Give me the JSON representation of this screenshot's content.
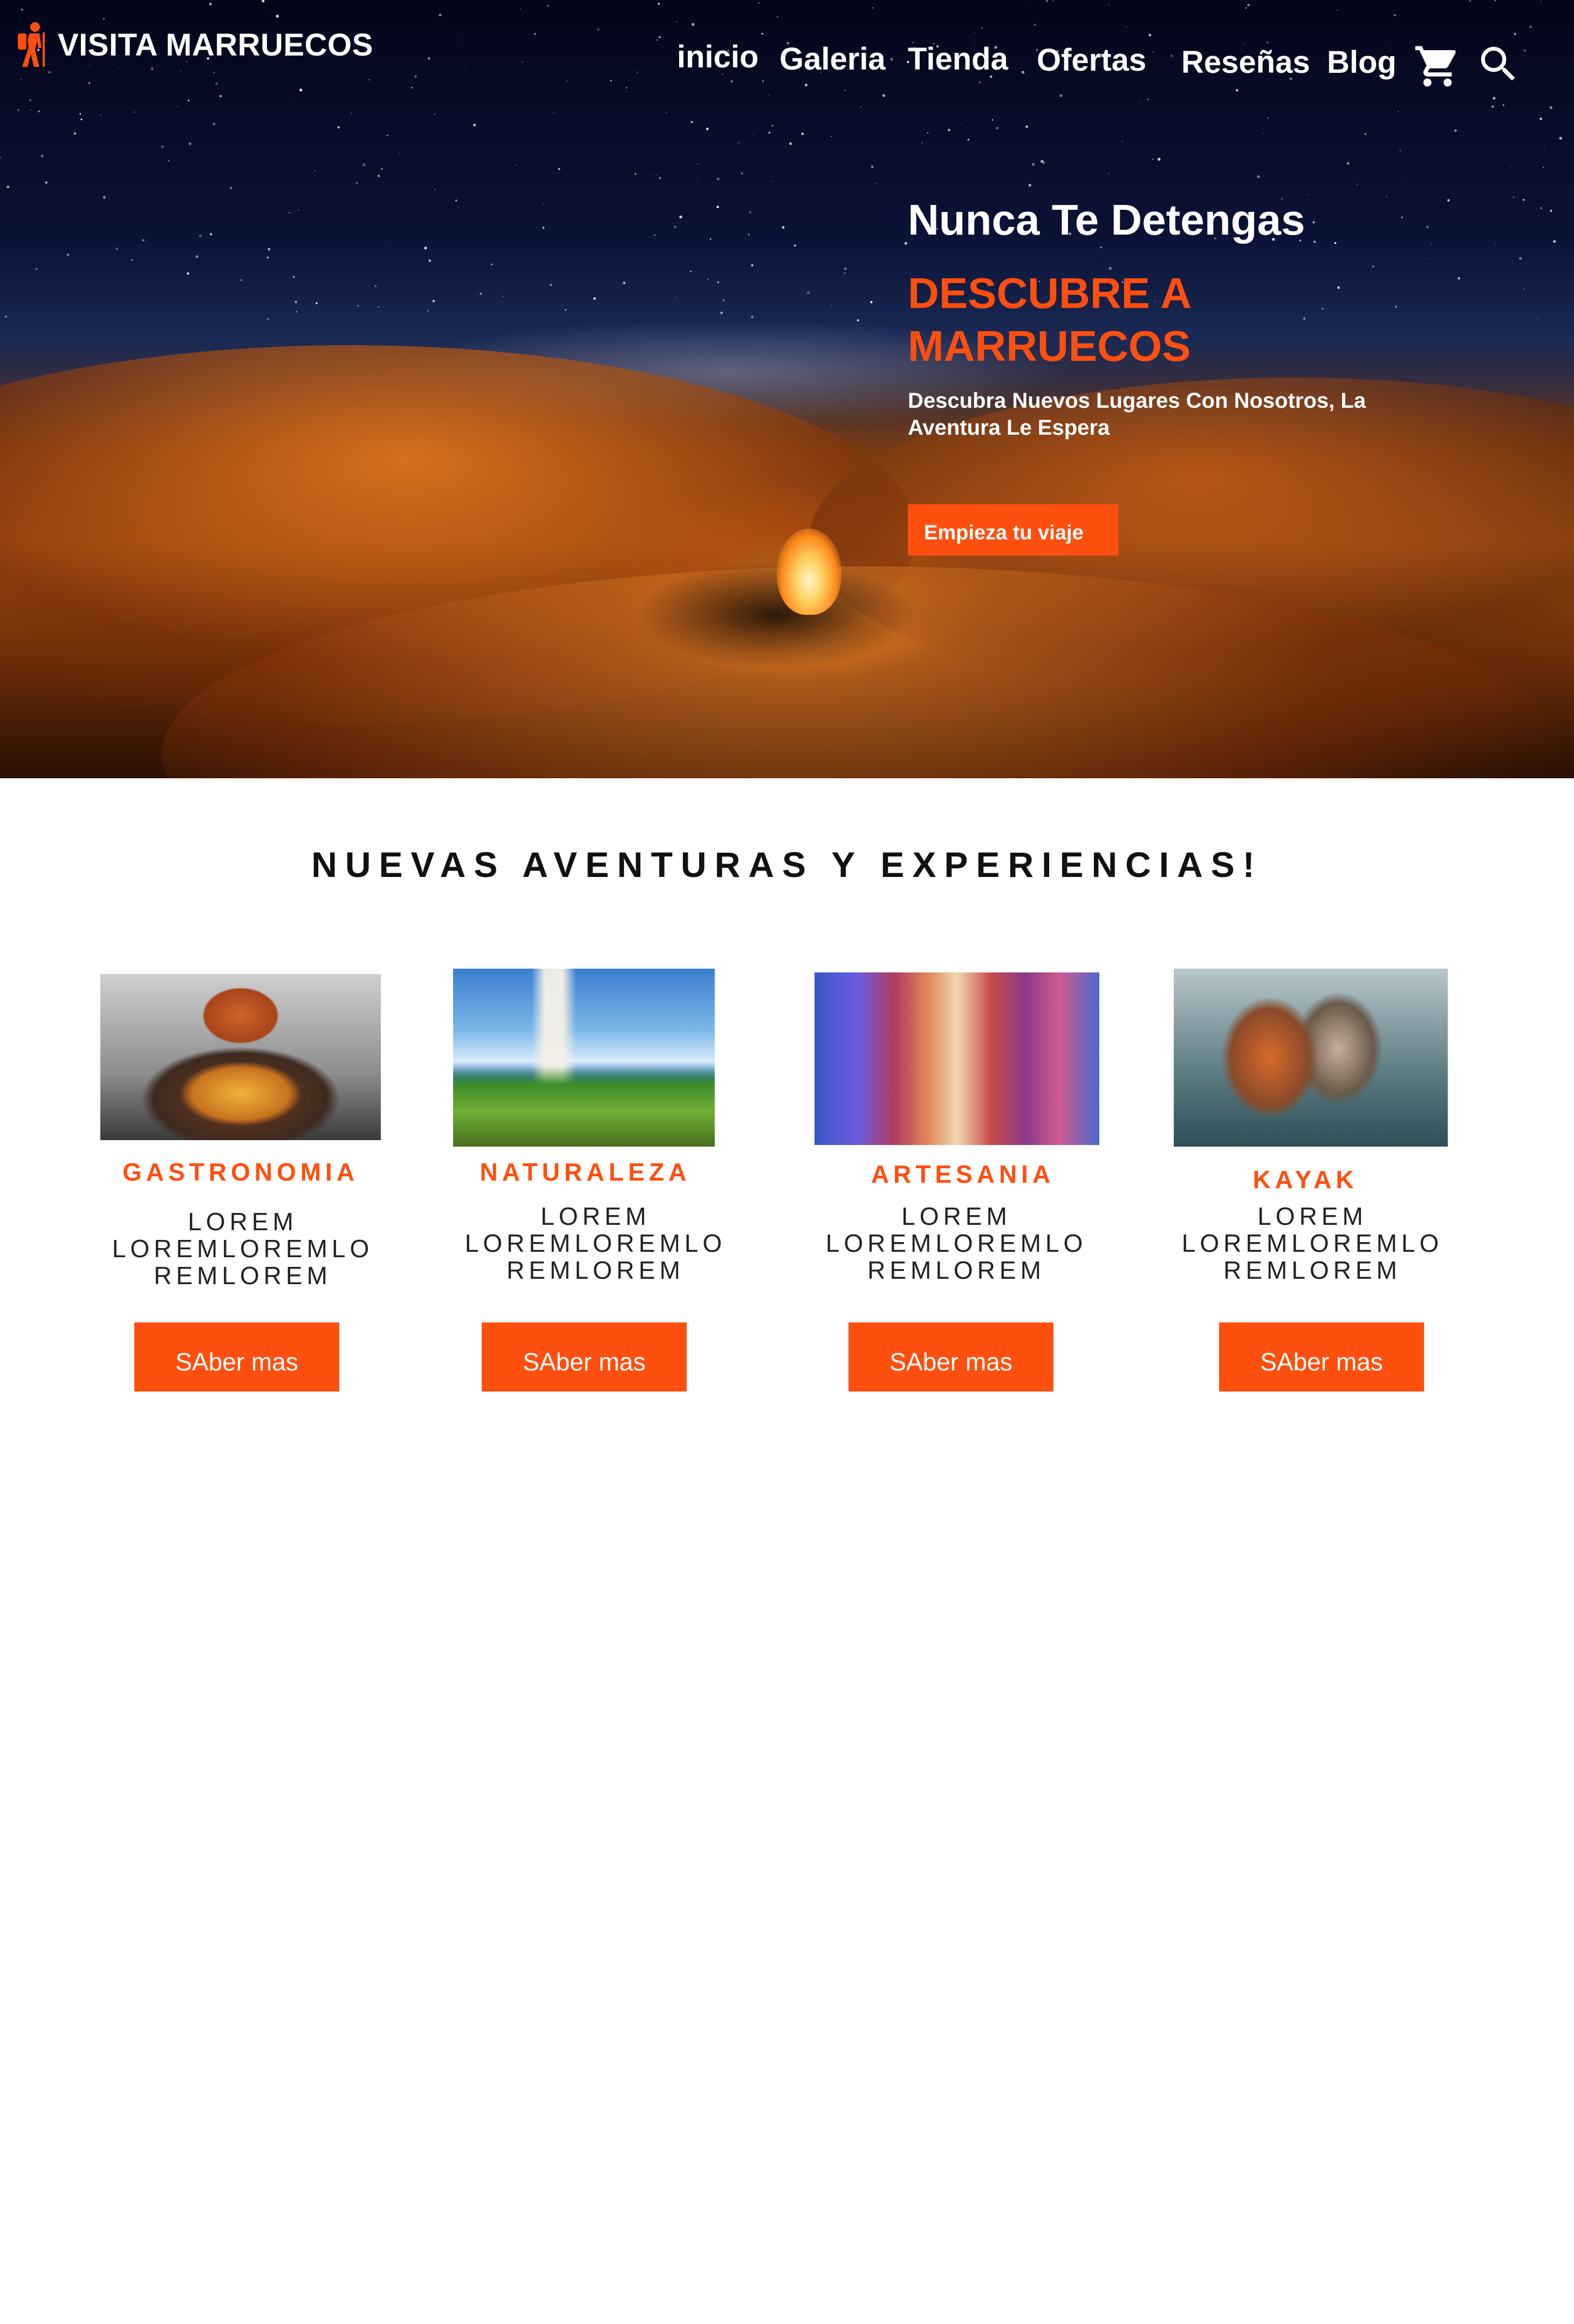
{
  "brand": {
    "name": "VISITA MARRUECOS",
    "accent_color": "#ff4f0f",
    "logo_icon": "hiker-icon"
  },
  "nav": {
    "items": [
      "inicio",
      "Galeria",
      "Tienda",
      "Ofertas",
      "Reseñas",
      "Blog"
    ],
    "cart_icon": "cart-icon",
    "search_icon": "search-icon"
  },
  "hero": {
    "subtitle": "Nunca Te Detengas",
    "title": "DESCUBRE A MARRUECOS",
    "description": "Descubra Nuevos Lugares Con Nosotros, La Aventura Le Espera",
    "button": "Empieza tu viaje"
  },
  "section": {
    "title": "NUEVAS AVENTURAS Y EXPERIENCIAS!",
    "cards": [
      {
        "label": "GASTRONOMIA",
        "text": "LOREM LOREMLOREMLO REMLOREM",
        "button": "SAber mas"
      },
      {
        "label": "NATURALEZA",
        "text": "LOREM LOREMLOREMLO REMLOREM",
        "button": "SAber mas"
      },
      {
        "label": "ARTESANIA",
        "text": "LOREM LOREMLOREMLO REMLOREM",
        "button": "SAber mas"
      },
      {
        "label": "KAYAK",
        "text": "LOREM LOREMLOREMLO REMLOREM",
        "button": "SAber mas"
      }
    ]
  }
}
